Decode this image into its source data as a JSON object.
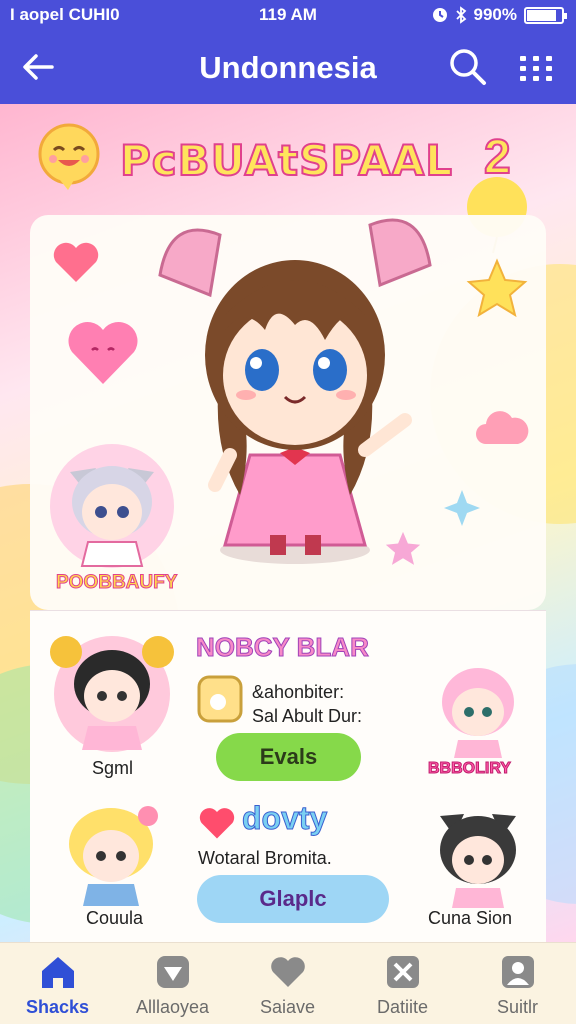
{
  "status_bar": {
    "carrier": "I aopel CUHI0",
    "time": "119 AM",
    "battery_text": "990%",
    "battery_level": 0.85
  },
  "app_bar": {
    "title": "Undonnesia"
  },
  "banner": {
    "title": "PcBUAtSPAAL",
    "number": "2"
  },
  "hero": {
    "side_character_label": "POOBBAUFY"
  },
  "cards": {
    "name_title": "NOBCY BLAR",
    "info_line1": "&ahonbiter:",
    "info_line2": "Sal Abult Dur:",
    "evals_button": "Evals",
    "rainbow_word": "dovty",
    "subtitle": "Wotaral Bromita.",
    "glaple_button": "Glaplc",
    "characters": {
      "top_left": "Sgml",
      "top_right": "BBBOLIRY",
      "bottom_left": "Couula",
      "bottom_right": "Cuna Sion"
    }
  },
  "bottom_nav": [
    {
      "label": "Shacks",
      "icon": "home-icon",
      "active": true
    },
    {
      "label": "Alllaoyea",
      "icon": "diamond-icon",
      "active": false
    },
    {
      "label": "Saiave",
      "icon": "heart-chat-icon",
      "active": false
    },
    {
      "label": "Datiite",
      "icon": "cross-tile-icon",
      "active": false
    },
    {
      "label": "Suitlr",
      "icon": "profile-icon",
      "active": false
    }
  ],
  "colors": {
    "app_bar": "#4a4fd9",
    "accent_pink": "#e0418d",
    "nav_active": "#2f4fd6",
    "evals_green": "#86d94a",
    "glaple_blue": "#9ed6f5"
  }
}
